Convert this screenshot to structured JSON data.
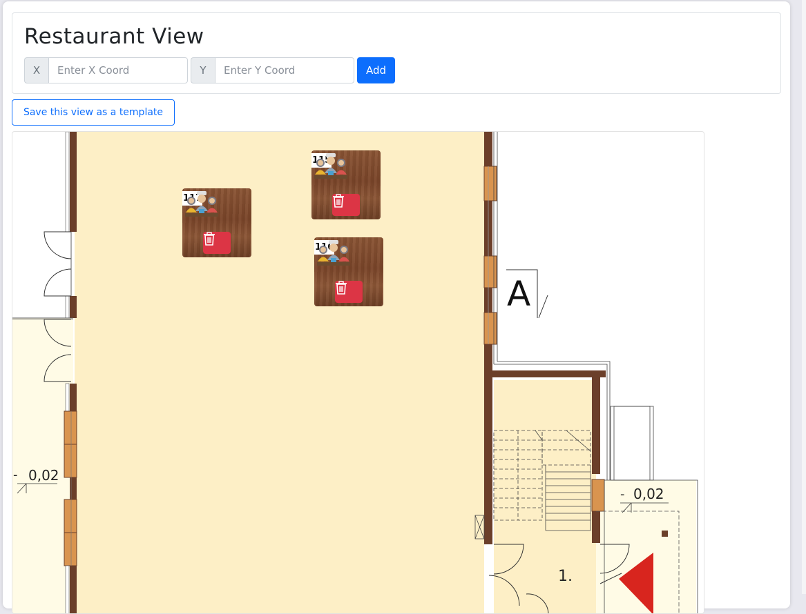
{
  "header": {
    "title": "Restaurant View",
    "x_label": "X",
    "x_placeholder": "Enter X Coord",
    "y_label": "Y",
    "y_placeholder": "Enter Y Coord",
    "add_label": "Add"
  },
  "save_template_label": "Save this view as a template",
  "floor_plan": {
    "section_label": "A",
    "level_left": "0,02",
    "level_right": "0,02",
    "room_number": "1."
  },
  "tables": [
    {
      "number": "117",
      "icon": "people-at-table-icon",
      "delete_icon": "trash-icon"
    },
    {
      "number": "115",
      "icon": "people-at-table-icon",
      "delete_icon": "trash-icon"
    },
    {
      "number": "116",
      "icon": "people-at-table-icon",
      "delete_icon": "trash-icon"
    }
  ],
  "colors": {
    "primary": "#0d6efd",
    "danger": "#dc3545",
    "floor": "#fdefc6",
    "wall": "#6b3f2a"
  }
}
